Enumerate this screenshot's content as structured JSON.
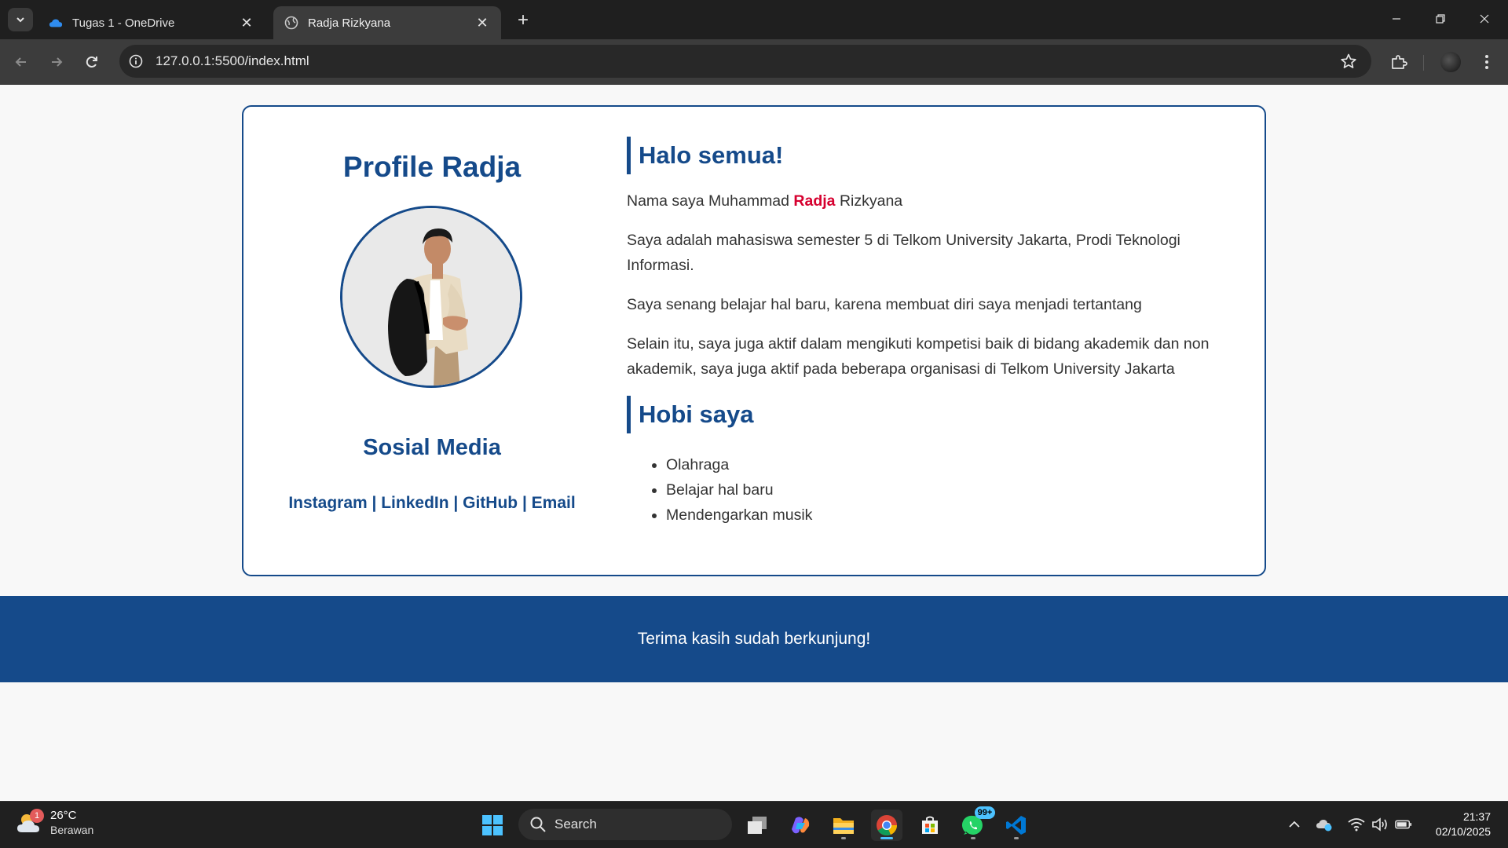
{
  "browser": {
    "tabs": [
      {
        "title": "Tugas 1 - OneDrive",
        "active": false,
        "favicon": "onedrive-cloud-icon"
      },
      {
        "title": "Radja Rizkyana",
        "active": true,
        "favicon": "globe-icon"
      }
    ],
    "url": "127.0.0.1:5500/index.html"
  },
  "page": {
    "profile_title": "Profile Radja",
    "social_title": "Sosial Media",
    "social_links": [
      "Instagram",
      "LinkedIn",
      "GitHub",
      "Email"
    ],
    "social_separator": " | ",
    "greeting_heading": "Halo semua!",
    "intro_before": "Nama saya Muhammad ",
    "intro_highlight": "Radja",
    "intro_after": " Rizkyana",
    "para_semester": "Saya adalah mahasiswa semester 5 di Telkom University Jakarta, Prodi Teknologi Informasi.",
    "para_learning": "Saya senang belajar hal baru, karena membuat diri saya menjadi tertantang",
    "para_active": "Selain itu, saya juga aktif dalam mengikuti kompetisi baik di bidang akademik dan non akademik, saya juga aktif pada beberapa organisasi di Telkom University Jakarta",
    "hobby_heading": "Hobi saya",
    "hobbies": [
      "Olahraga",
      "Belajar hal baru",
      "Mendengarkan musik"
    ],
    "footer_text": "Terima kasih sudah berkunjung!",
    "colors": {
      "primary": "#154a8a",
      "highlight": "#d6002f",
      "text": "#333333"
    }
  },
  "taskbar": {
    "weather_temp": "26°C",
    "weather_condition": "Berawan",
    "weather_badge": "1",
    "search_placeholder": "Search",
    "whatsapp_badge": "99+",
    "time": "21:37",
    "date": "02/10/2025"
  }
}
